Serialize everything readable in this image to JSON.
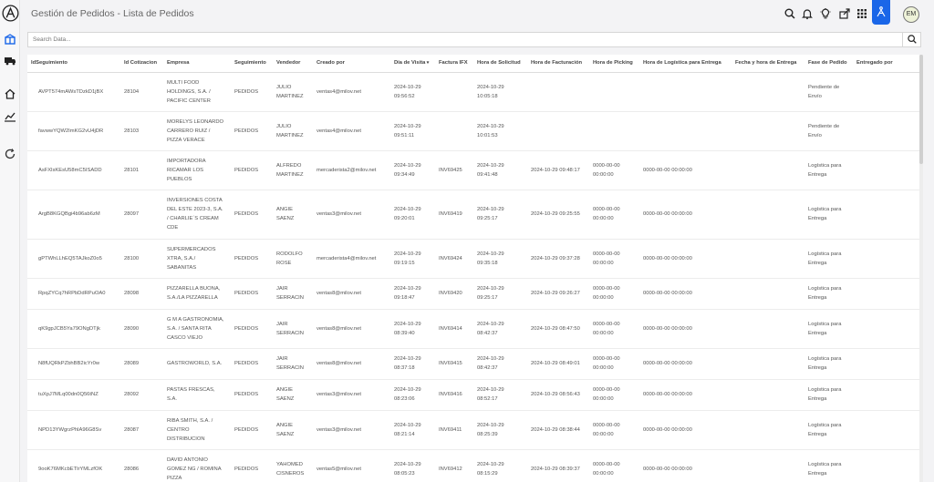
{
  "header": {
    "title": "Gestión de Pedidos - Lista de Pedidos",
    "avatar_initials": "EM",
    "accent_color": "#1a66e8"
  },
  "search": {
    "placeholder": "Search Data..."
  },
  "columns": [
    "IdSeguimiento",
    "Id Cotizacion",
    "Empresa",
    "Seguimiento",
    "Vendedor",
    "Creado por",
    "Día de Visita",
    "Factura IFX",
    "Hora de Solicitud",
    "Hora de Facturación",
    "Hora de Picking",
    "Hora de Logística para Entrega",
    "Fecha y hora de Entrega",
    "Fase de Pedido",
    "Entregado por"
  ],
  "sort_indicator": "▾",
  "rows": [
    {
      "id": "AVPT574mAWsTDzkD1jBX",
      "cot": "28104",
      "empresa": [
        "MULTI FOOD",
        "HOLDINGS, S.A. /",
        "PACIFIC CENTER"
      ],
      "seg": "PEDIDOS",
      "vend": [
        "JULIO",
        "MARTINEZ"
      ],
      "creado": "ventas4@milov.net",
      "visita": [
        "2024-10-29",
        "09:56:52"
      ],
      "factura": "",
      "solicitud": [
        "2024-10-29",
        "10:05:18"
      ],
      "facturacion": "",
      "picking": [],
      "logistica": "",
      "entrega": "",
      "fase": [
        "Pendiente de",
        "Envío"
      ],
      "entregado": ""
    },
    {
      "id": "favwwYQW2ImKG2vU4jDR",
      "cot": "28103",
      "empresa": [
        "MORELYS LEONARDO",
        "CARRERO RUIZ /",
        "PIZZA VERACE"
      ],
      "seg": "PEDIDOS",
      "vend": [
        "JULIO",
        "MARTINEZ"
      ],
      "creado": "ventas4@milov.net",
      "visita": [
        "2024-10-29",
        "09:51:11"
      ],
      "factura": "",
      "solicitud": [
        "2024-10-29",
        "10:01:53"
      ],
      "facturacion": "",
      "picking": [],
      "logistica": "",
      "entrega": "",
      "fase": [
        "Pendiente de",
        "Envío"
      ],
      "entregado": ""
    },
    {
      "id": "AsFXlsKEsU58mC5ISADD",
      "cot": "28101",
      "empresa": [
        "IMPORTADORA",
        "RICAMAR LOS",
        "PUEBLOS"
      ],
      "seg": "PEDIDOS",
      "vend": [
        "ALFREDO",
        "MARTINEZ"
      ],
      "creado": "mercaderista2@milov.net",
      "visita": [
        "2024-10-29",
        "09:34:49"
      ],
      "factura": "INV69425",
      "solicitud": [
        "2024-10-29",
        "09:41:48"
      ],
      "facturacion": "2024-10-29 09:48:17",
      "picking": [
        "0000-00-00",
        "00:00:00"
      ],
      "logistica": "0000-00-00 00:00:00",
      "entrega": "",
      "fase": [
        "Logística para",
        "Entrega"
      ],
      "entregado": ""
    },
    {
      "id": "ArgB8KGQBgi4b96ab6zM",
      "cot": "28097",
      "empresa": [
        "INVERSIONES COSTA",
        "DEL ESTE 2023-3, S.A.",
        "/ CHARLIE´S CREAM",
        "CDE"
      ],
      "seg": "PEDIDOS",
      "vend": [
        "ANGIE",
        "SAENZ"
      ],
      "creado": "ventas3@milov.net",
      "visita": [
        "2024-10-29",
        "09:20:01"
      ],
      "factura": "INV69419",
      "solicitud": [
        "2024-10-29",
        "09:25:17"
      ],
      "facturacion": "2024-10-29 09:25:55",
      "picking": [
        "0000-00-00",
        "00:00:00"
      ],
      "logistica": "0000-00-00 00:00:00",
      "entrega": "",
      "fase": [
        "Logística para",
        "Entrega"
      ],
      "entregado": ""
    },
    {
      "id": "gPTWhLLhEQ5TAJkoZ0o5",
      "cot": "28100",
      "empresa": [
        "SUPERMERCADOS",
        "XTRA, S.A./",
        "SABANITAS"
      ],
      "seg": "PEDIDOS",
      "vend": [
        "RODOLFO",
        "ROSE"
      ],
      "creado": "mercaderista4@milov.net",
      "visita": [
        "2024-10-29",
        "09:19:15"
      ],
      "factura": "INV69424",
      "solicitud": [
        "2024-10-29",
        "09:35:18"
      ],
      "facturacion": "2024-10-29 09:37:28",
      "picking": [
        "0000-00-00",
        "00:00:00"
      ],
      "logistica": "0000-00-00 00:00:00",
      "entrega": "",
      "fase": [
        "Logística para",
        "Entrega"
      ],
      "entregado": ""
    },
    {
      "id": "RpqZYCq7hRPbDdRPuOA0",
      "cot": "28098",
      "empresa": [
        "PIZZARELLA BUONA,",
        "S.A./LA PIZZARELLA"
      ],
      "seg": "PEDIDOS",
      "vend": [
        "JAIR",
        "SERRACIN"
      ],
      "creado": "ventas8@milov.net",
      "visita": [
        "2024-10-29",
        "09:18:47"
      ],
      "factura": "INV69420",
      "solicitud": [
        "2024-10-29",
        "09:25:17"
      ],
      "facturacion": "2024-10-29 09:26:27",
      "picking": [
        "0000-00-00",
        "00:00:00"
      ],
      "logistica": "0000-00-00 00:00:00",
      "entrega": "",
      "fase": [
        "Logística para",
        "Entrega"
      ],
      "entregado": ""
    },
    {
      "id": "qK9gpJCB5Ya79ONgDTjk",
      "cot": "28090",
      "empresa": [
        "G M A GASTRONOMIA,",
        "S.A. / SANTA RITA",
        "CASCO VIEJO"
      ],
      "seg": "PEDIDOS",
      "vend": [
        "JAIR",
        "SERRACIN"
      ],
      "creado": "ventas8@milov.net",
      "visita": [
        "2024-10-29",
        "08:39:40"
      ],
      "factura": "INV69414",
      "solicitud": [
        "2024-10-29",
        "08:42:37"
      ],
      "facturacion": "2024-10-29 08:47:50",
      "picking": [
        "0000-00-00",
        "00:00:00"
      ],
      "logistica": "0000-00-00 00:00:00",
      "entrega": "",
      "fase": [
        "Logística para",
        "Entrega"
      ],
      "entregado": ""
    },
    {
      "id": "N8fUQRkPZbhBB2icYr0w",
      "cot": "28089",
      "empresa": [
        "GASTROWORLD, S.A."
      ],
      "seg": "PEDIDOS",
      "vend": [
        "JAIR",
        "SERRACIN"
      ],
      "creado": "ventas8@milov.net",
      "visita": [
        "2024-10-29",
        "08:37:18"
      ],
      "factura": "INV69415",
      "solicitud": [
        "2024-10-29",
        "08:42:37"
      ],
      "facturacion": "2024-10-29 08:49:01",
      "picking": [
        "0000-00-00",
        "00:00:00"
      ],
      "logistica": "0000-00-00 00:00:00",
      "entrega": "",
      "fase": [
        "Logística para",
        "Entrega"
      ],
      "entregado": ""
    },
    {
      "id": "tuXpJ7MLq00dn0Q56tNZ",
      "cot": "28092",
      "empresa": [
        "PASTAS FRESCAS,",
        "S.A."
      ],
      "seg": "PEDIDOS",
      "vend": [
        "ANGIE",
        "SAENZ"
      ],
      "creado": "ventas3@milov.net",
      "visita": [
        "2024-10-29",
        "08:23:06"
      ],
      "factura": "INV69416",
      "solicitud": [
        "2024-10-29",
        "08:52:17"
      ],
      "facturacion": "2024-10-29 08:56:43",
      "picking": [
        "0000-00-00",
        "00:00:00"
      ],
      "logistica": "0000-00-00 00:00:00",
      "entrega": "",
      "fase": [
        "Logística para",
        "Entrega"
      ],
      "entregado": ""
    },
    {
      "id": "NPD13YWgrzPhlA96G8Sv",
      "cot": "28087",
      "empresa": [
        "RIBA SMITH, S.A. /",
        "CENTRO",
        "DISTRIBUCION"
      ],
      "seg": "PEDIDOS",
      "vend": [
        "ANGIE",
        "SAENZ"
      ],
      "creado": "ventas3@milov.net",
      "visita": [
        "2024-10-29",
        "08:21:14"
      ],
      "factura": "INV69411",
      "solicitud": [
        "2024-10-29",
        "08:25:39"
      ],
      "facturacion": "2024-10-29 08:38:44",
      "picking": [
        "0000-00-00",
        "00:00:00"
      ],
      "logistica": "0000-00-00 00:00:00",
      "entrega": "",
      "fase": [
        "Logística para",
        "Entrega"
      ],
      "entregado": ""
    },
    {
      "id": "9ooK76MKcbETlrYMLzfOK",
      "cot": "28086",
      "empresa": [
        "DAVID ANTONIO",
        "GOMEZ NG / ROMINA",
        "PIZZA"
      ],
      "seg": "PEDIDOS",
      "vend": [
        "YAHOMED",
        "CISNEROS"
      ],
      "creado": "ventas5@milov.net",
      "visita": [
        "2024-10-29",
        "08:05:23"
      ],
      "factura": "INV69412",
      "solicitud": [
        "2024-10-29",
        "08:15:29"
      ],
      "facturacion": "2024-10-29 08:39:37",
      "picking": [
        "0000-00-00",
        "00:00:00"
      ],
      "logistica": "0000-00-00 00:00:00",
      "entrega": "",
      "fase": [
        "Logística para",
        "Entrega"
      ],
      "entregado": ""
    }
  ]
}
